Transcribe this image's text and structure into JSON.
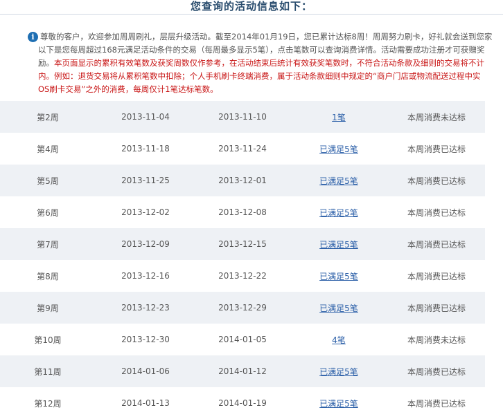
{
  "page_title": "您查询的活动信息如下：",
  "notice": {
    "line1": "尊敬的客户，欢迎参加周周刷礼，层层升级活动。截至2014年01月19日，您已累计达标8周！周周努力刷卡，好礼就会送到您家",
    "line2": "以下是您每周超过168元满足活动条件的交易（每周最多显示5笔），点击笔数可以查询消费详情。活动需要成功注册才可获赠奖",
    "line3_gray": "励。",
    "line3_red": "本页面显示的累积有效笔数及获奖周数仅作参考，在活动结束后统计有效获奖笔数时，不符合活动条款及细则的交易将不计",
    "line4": "内。例如：退货交易将从累积笔数中扣除；个人手机刷卡终端消费，属于活动条款细则中规定的“商户门店或物流配送过程中实",
    "line5": "OS刷卡交易”之外的消费，每周仅计1笔达标笔数。"
  },
  "rows": [
    {
      "week": "第2周",
      "start": "2013-11-04",
      "end": "2013-11-10",
      "count": "1笔",
      "status": "本周消费未达标"
    },
    {
      "week": "第4周",
      "start": "2013-11-18",
      "end": "2013-11-24",
      "count": "已满足5笔",
      "status": "本周消费已达标"
    },
    {
      "week": "第5周",
      "start": "2013-11-25",
      "end": "2013-12-01",
      "count": "已满足5笔",
      "status": "本周消费已达标"
    },
    {
      "week": "第6周",
      "start": "2013-12-02",
      "end": "2013-12-08",
      "count": "已满足5笔",
      "status": "本周消费已达标"
    },
    {
      "week": "第7周",
      "start": "2013-12-09",
      "end": "2013-12-15",
      "count": "已满足5笔",
      "status": "本周消费已达标"
    },
    {
      "week": "第8周",
      "start": "2013-12-16",
      "end": "2013-12-22",
      "count": "已满足5笔",
      "status": "本周消费已达标"
    },
    {
      "week": "第9周",
      "start": "2013-12-23",
      "end": "2013-12-29",
      "count": "已满足5笔",
      "status": "本周消费已达标"
    },
    {
      "week": "第10周",
      "start": "2013-12-30",
      "end": "2014-01-05",
      "count": "4笔",
      "status": "本周消费未达标"
    },
    {
      "week": "第11周",
      "start": "2014-01-06",
      "end": "2014-01-12",
      "count": "已满足5笔",
      "status": "本周消费已达标"
    },
    {
      "week": "第12周",
      "start": "2014-01-13",
      "end": "2014-01-19",
      "count": "已满足5笔",
      "status": "本周消费已达标"
    }
  ]
}
